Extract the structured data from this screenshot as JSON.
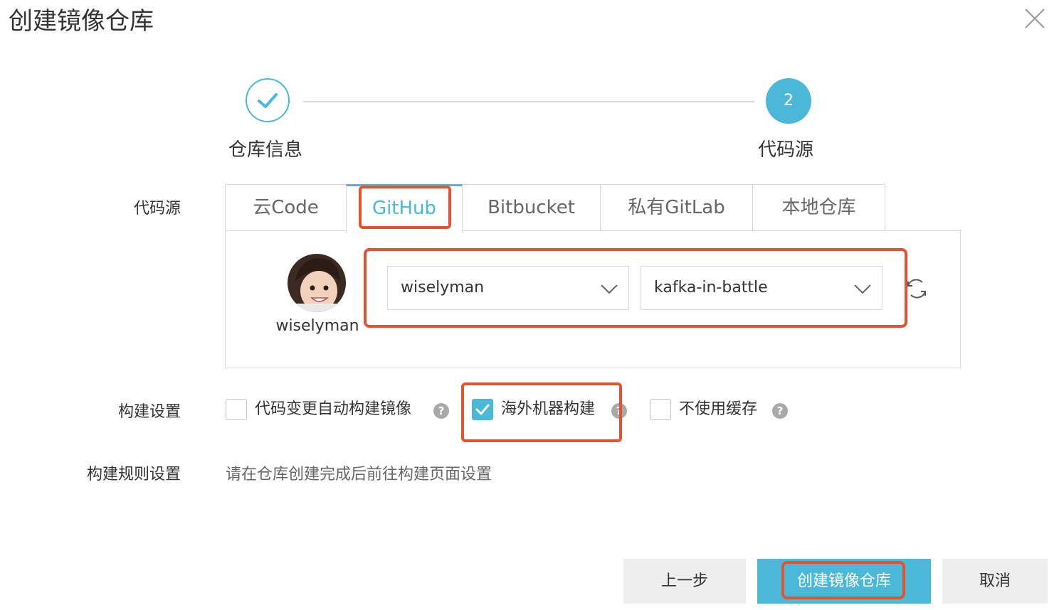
{
  "dialog": {
    "title": "创建镜像仓库"
  },
  "steps": [
    {
      "label": "仓库信息",
      "state": "done"
    },
    {
      "number": "2",
      "label": "代码源",
      "state": "current"
    }
  ],
  "source": {
    "label": "代码源",
    "tabs": [
      "云Code",
      "GitHub",
      "Bitbucket",
      "私有GitLab",
      "本地仓库"
    ],
    "active_tab": "GitHub",
    "user": {
      "name": "wiselyman"
    },
    "namespace_select": {
      "value": "wiselyman"
    },
    "repo_select": {
      "value": "kafka-in-battle"
    },
    "refresh_icon": "refresh-icon"
  },
  "build_settings": {
    "label": "构建设置",
    "options": [
      {
        "label": "代码变更自动构建镜像",
        "checked": false
      },
      {
        "label": "海外机器构建",
        "checked": true
      },
      {
        "label": "不使用缓存",
        "checked": false
      }
    ],
    "help_glyph": "?"
  },
  "build_rules": {
    "label": "构建规则设置",
    "text": "请在仓库创建完成后前往构建页面设置"
  },
  "footer": {
    "prev_label": "上一步",
    "create_label": "创建镜像仓库",
    "cancel_label": "取消"
  },
  "colors": {
    "accent": "#4ab8d6",
    "highlight": "#e4532f",
    "border": "#d9d9d9"
  }
}
